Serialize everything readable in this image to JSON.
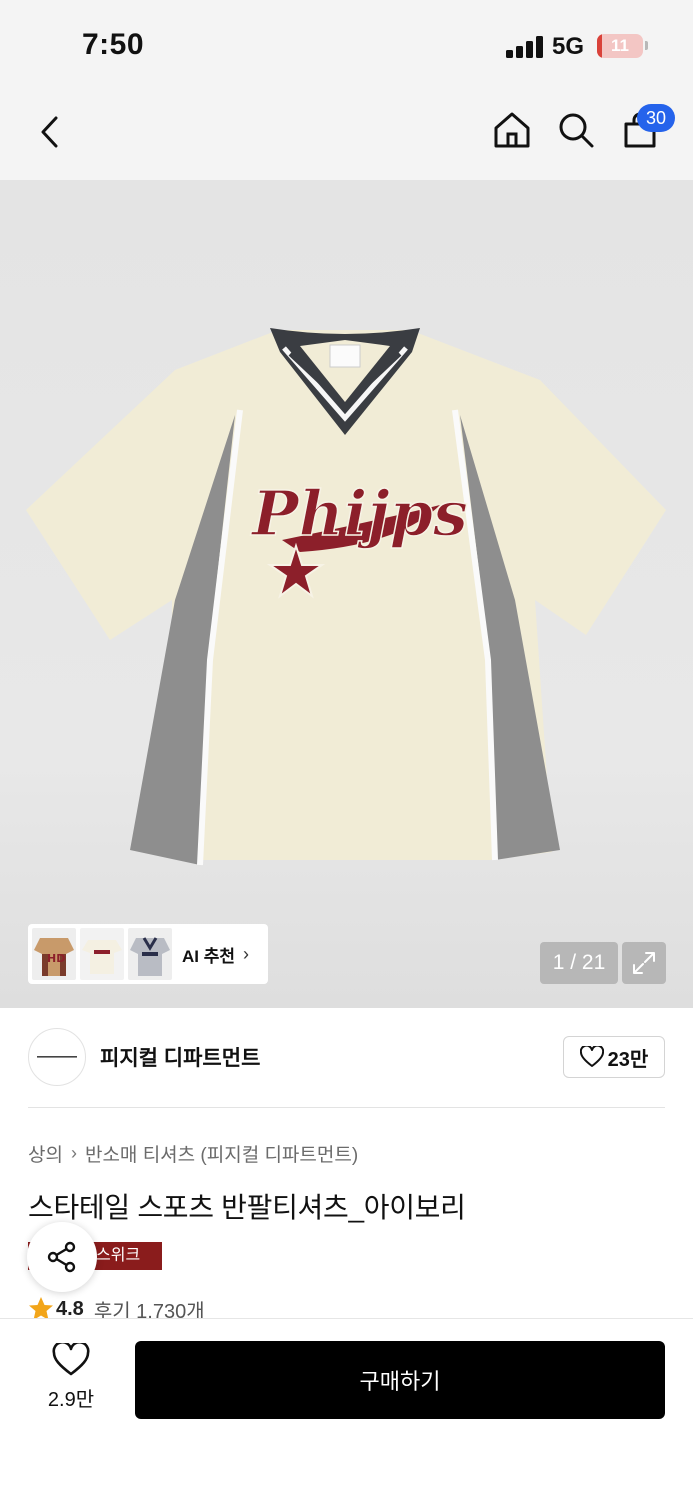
{
  "status_bar": {
    "time": "7:50",
    "network": "5G",
    "battery_level": "11",
    "battery_fraction": 0.11,
    "battery_color": "#d9423a"
  },
  "nav": {
    "icons": [
      "back-chevron-icon",
      "home-icon",
      "search-icon",
      "shopping-bag-icon"
    ],
    "cart_count": "30",
    "badge_color": "#2563eb"
  },
  "gallery": {
    "ai_recommend_label": "AI 추천",
    "image_counter": "1 / 21",
    "shirt_print_text": "Phijps"
  },
  "brand": {
    "name": "피지컬 디파트먼트",
    "likes": "23만"
  },
  "product": {
    "breadcrumb": [
      "상의",
      "반소매 티셔츠 (피지컬 디파트먼트)"
    ],
    "title": "스타테일 스포츠 반팔티셔츠_아이보리",
    "promo_badge": "스위크",
    "promo_color": "#8a1c1c",
    "rating": "4.8",
    "reviews": "후기 1,730개"
  },
  "bottom": {
    "wish_count": "2.9만",
    "buy_label": "구매하기"
  }
}
